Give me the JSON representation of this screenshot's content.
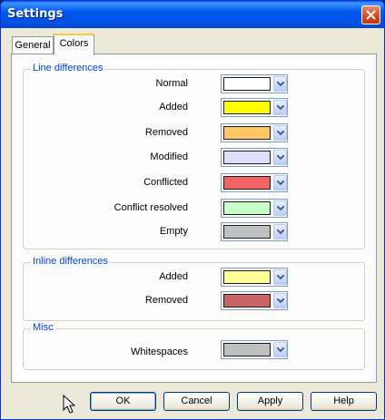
{
  "window": {
    "title": "Settings"
  },
  "tabs": [
    {
      "label": "General",
      "active": false
    },
    {
      "label": "Colors",
      "active": true
    }
  ],
  "groups": {
    "line_differences": {
      "label": "Line differences",
      "rows": [
        {
          "label": "Normal",
          "color": "#ffffff"
        },
        {
          "label": "Added",
          "color": "#ffff00"
        },
        {
          "label": "Removed",
          "color": "#ffc864"
        },
        {
          "label": "Modified",
          "color": "#dce0fa"
        },
        {
          "label": "Conflicted",
          "color": "#f06464"
        },
        {
          "label": "Conflict resolved",
          "color": "#c8ffc8"
        },
        {
          "label": "Empty",
          "color": "#c0c0c0"
        }
      ]
    },
    "inline_differences": {
      "label": "Inline differences",
      "rows": [
        {
          "label": "Added",
          "color": "#ffff96"
        },
        {
          "label": "Removed",
          "color": "#c86464"
        }
      ]
    },
    "misc": {
      "label": "Misc",
      "rows": [
        {
          "label": "Whitespaces",
          "color": "#c0c0c0"
        }
      ]
    }
  },
  "buttons": {
    "ok": "OK",
    "cancel": "Cancel",
    "apply": "Apply",
    "help": "Help"
  }
}
